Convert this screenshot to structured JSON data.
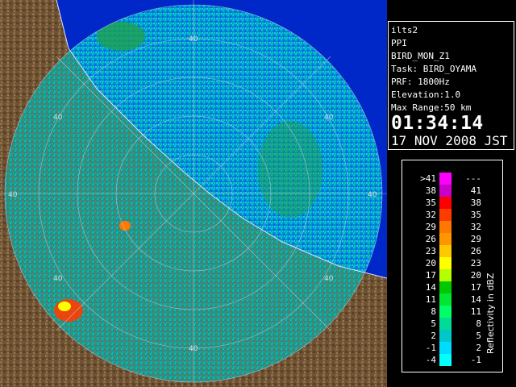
{
  "radar_info": {
    "radar_name": "ilts2",
    "product": "PPI",
    "scan_name": "BIRD_MON_Z1",
    "task": "Task: BIRD_OYAMA",
    "prf": "PRF: 1800Hz",
    "elevation": "Elevation:1.0",
    "max_range": "Max Range:50 km",
    "time": "01:34:14",
    "date": "17 NOV 2008 JST"
  },
  "legend": {
    "unit_label": "Reflectivity in dBZ",
    "rows": [
      {
        "low": ">41",
        "high": "---",
        "color": "#ff00ff"
      },
      {
        "low": "38",
        "high": "41",
        "color": "#c800c8"
      },
      {
        "low": "35",
        "high": "38",
        "color": "#ff0000"
      },
      {
        "low": "32",
        "high": "35",
        "color": "#ff3c00"
      },
      {
        "low": "29",
        "high": "32",
        "color": "#ff7800"
      },
      {
        "low": "26",
        "high": "29",
        "color": "#ff9600"
      },
      {
        "low": "23",
        "high": "26",
        "color": "#ffc800"
      },
      {
        "low": "20",
        "high": "23",
        "color": "#ffff00"
      },
      {
        "low": "17",
        "high": "20",
        "color": "#b4ff00"
      },
      {
        "low": "14",
        "high": "17",
        "color": "#00c800"
      },
      {
        "low": "11",
        "high": "14",
        "color": "#00e632"
      },
      {
        "low": "8",
        "high": "11",
        "color": "#00ff64"
      },
      {
        "low": "5",
        "high": "8",
        "color": "#00dc96"
      },
      {
        "low": "2",
        "high": "5",
        "color": "#00c8c8"
      },
      {
        "low": "-1",
        "high": "2",
        "color": "#00dcff"
      },
      {
        "low": "-4",
        "high": "-1",
        "color": "#00ffff"
      }
    ]
  },
  "map": {
    "range_ring_labels": [
      "40",
      "40",
      "40",
      "40",
      "40",
      "40",
      "40",
      "40"
    ],
    "colors": {
      "sea": "#0028c8",
      "land": "#7a5a3a",
      "echo": "#00a0c8"
    }
  }
}
